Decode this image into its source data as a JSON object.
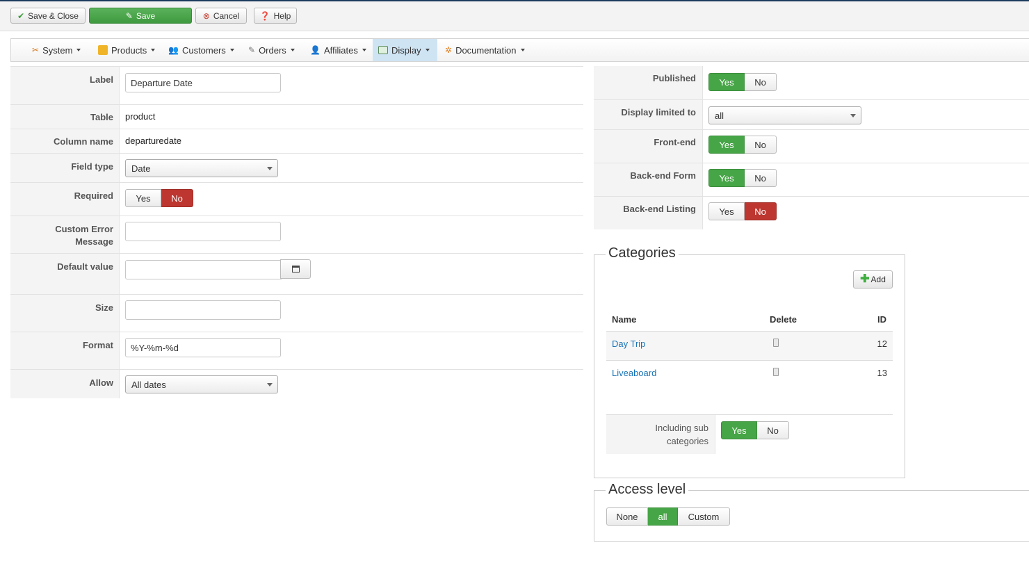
{
  "toolbar": {
    "save_close": "Save & Close",
    "save": "Save",
    "cancel": "Cancel",
    "help": "Help"
  },
  "menu": {
    "system": "System",
    "products": "Products",
    "customers": "Customers",
    "orders": "Orders",
    "affiliates": "Affiliates",
    "display": "Display",
    "documentation": "Documentation"
  },
  "form": {
    "label": {
      "label": "Label",
      "value": "Departure Date"
    },
    "table": {
      "label": "Table",
      "value": "product"
    },
    "column_name": {
      "label": "Column name",
      "value": "departuredate"
    },
    "field_type": {
      "label": "Field type",
      "value": "Date"
    },
    "required": {
      "label": "Required",
      "yes": "Yes",
      "no": "No",
      "selected": "No"
    },
    "custom_error": {
      "label_line1": "Custom Error",
      "label_line2": "Message",
      "value": ""
    },
    "default_value": {
      "label": "Default value",
      "value": ""
    },
    "size": {
      "label": "Size",
      "value": ""
    },
    "format": {
      "label": "Format",
      "value": "%Y-%m-%d"
    },
    "allow": {
      "label": "Allow",
      "value": "All dates"
    }
  },
  "settings": {
    "published": {
      "label": "Published",
      "yes": "Yes",
      "no": "No",
      "selected": "Yes"
    },
    "display_limited": {
      "label": "Display limited to",
      "value": "all"
    },
    "front_end": {
      "label": "Front-end",
      "yes": "Yes",
      "no": "No",
      "selected": "Yes"
    },
    "backend_form": {
      "label": "Back-end Form",
      "yes": "Yes",
      "no": "No",
      "selected": "Yes"
    },
    "backend_listing": {
      "label": "Back-end Listing",
      "yes": "Yes",
      "no": "No",
      "selected": "No"
    }
  },
  "categories": {
    "legend": "Categories",
    "add": "Add",
    "headers": {
      "name": "Name",
      "delete": "Delete",
      "id": "ID"
    },
    "rows": [
      {
        "name": "Day Trip",
        "id": "12"
      },
      {
        "name": "Liveaboard",
        "id": "13"
      }
    ],
    "including_sub": {
      "label_line1": "Including sub",
      "label_line2": "categories",
      "yes": "Yes",
      "no": "No",
      "selected": "Yes"
    }
  },
  "access": {
    "legend": "Access level",
    "options": [
      "None",
      "all",
      "Custom"
    ],
    "selected": "all"
  },
  "colors": {
    "green": "#46a546",
    "red": "#bd362f",
    "link": "#1a74b6",
    "active_menu": "#cfe4f3"
  }
}
